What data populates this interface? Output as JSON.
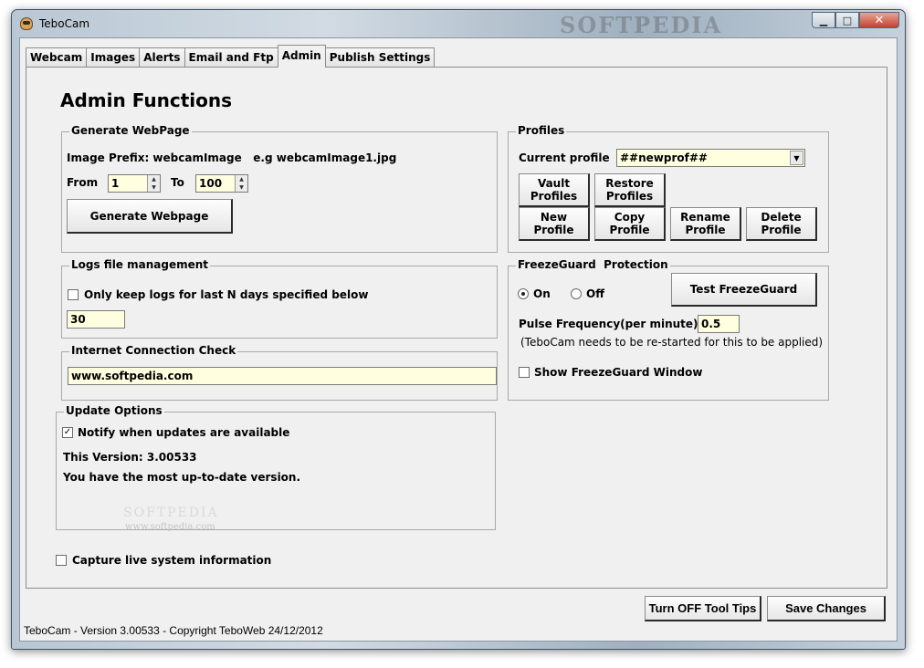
{
  "window": {
    "title": "TeboCam",
    "watermark": "SOFTPEDIA",
    "minimize": "▁",
    "maximize": "□",
    "close": "✕"
  },
  "tabs": [
    "Webcam",
    "Images",
    "Alerts",
    "Email and Ftp",
    "Admin",
    "Publish Settings"
  ],
  "active_tab": "Admin",
  "page": {
    "heading": "Admin Functions"
  },
  "generate_webpage": {
    "legend": "Generate WebPage",
    "prefix_label": "Image Prefix: webcamImage   e.g webcamImage1.jpg",
    "from_label": "From",
    "from_value": "1",
    "to_label": "To",
    "to_value": "100",
    "button": "Generate Webpage"
  },
  "profiles": {
    "legend": "Profiles",
    "current_label": "Current profile",
    "current_value": "##newprof##",
    "vault": [
      "Vault",
      "Profiles"
    ],
    "restore": [
      "Restore",
      "Profiles"
    ],
    "new": [
      "New",
      "Profile"
    ],
    "copy": [
      "Copy",
      "Profile"
    ],
    "rename": [
      "Rename",
      "Profile"
    ],
    "delete": [
      "Delete",
      "Profile"
    ]
  },
  "logs": {
    "legend": "Logs file management",
    "checkbox_label": "Only keep logs for last N days specified below",
    "checked": false,
    "days_value": "30"
  },
  "freezeguard": {
    "legend": "FreezeGuard  Protection",
    "on_label": "On",
    "off_label": "Off",
    "selected": "On",
    "test_button": "Test FreezeGuard",
    "pulse_label": "Pulse Frequency(per minute)",
    "pulse_value": "0.5",
    "note": "(TeboCam needs to be re-started for this to be applied)",
    "show_window_label": "Show FreezeGuard Window",
    "show_window_checked": false
  },
  "internet": {
    "legend": "Internet Connection Check",
    "url_value": "www.softpedia.com"
  },
  "updates": {
    "legend": "Update Options",
    "notify_label": "Notify when updates are available",
    "notify_checked": true,
    "check_mark": "✓",
    "this_version": "This Version: 3.00533",
    "status": "You have the most up-to-date version.",
    "watermark_big": "SOFTPEDIA",
    "watermark_url": "www.softpedia.com"
  },
  "capture": {
    "label": "Capture live system information",
    "checked": false
  },
  "footer": {
    "tooltips_button": "Turn OFF Tool Tips",
    "save_button": "Save Changes",
    "status_text": "TeboCam - Version 3.00533 - Copyright TeboWeb 24/12/2012"
  }
}
